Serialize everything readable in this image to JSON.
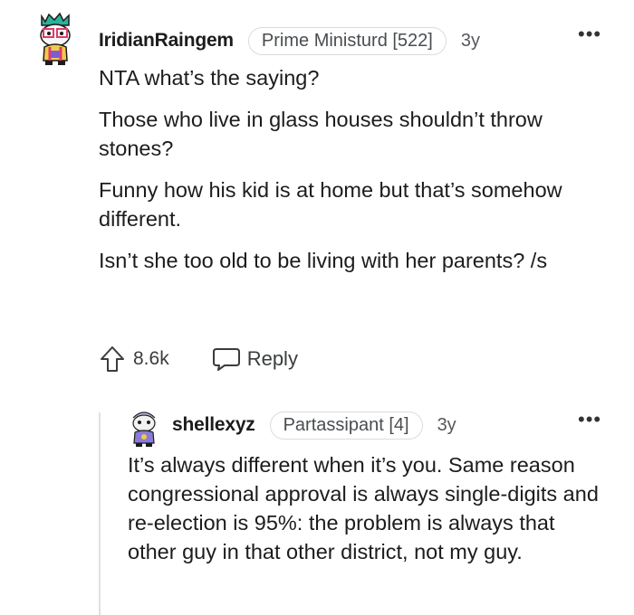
{
  "comment": {
    "username": "IridianRaingem",
    "flair": "Prime Ministurd [522]",
    "age": "3y",
    "more": "•••",
    "paragraphs": [
      "NTA what’s the saying?",
      "Those who live in glass houses shouldn’t throw stones?",
      "Funny how his kid is at home but that’s somehow different.",
      "Isn’t she too old to be living with her parents? /s"
    ],
    "score": "8.6k",
    "reply_label": "Reply"
  },
  "reply": {
    "username": "shellexyz",
    "flair": "Partassipant [4]",
    "age": "3y",
    "more": "•••",
    "text": "It’s always different when it’s you. Same reason congressional approval is always single-digits and re-election is 95%: the problem is always that other guy in that other district, not my guy."
  },
  "colors": {
    "text": "#1c1c1c",
    "muted": "#56585b",
    "border": "#d9dcdf",
    "avatar_1_accent": "#2bb39a",
    "avatar_2_accent": "#8a7bd6"
  },
  "icons": {
    "avatar_1": "snoo-avatar-icon",
    "avatar_2": "snoo-avatar-icon",
    "upvote": "upvote-arrow-icon",
    "reply": "speech-bubble-icon",
    "more": "ellipsis-icon"
  }
}
